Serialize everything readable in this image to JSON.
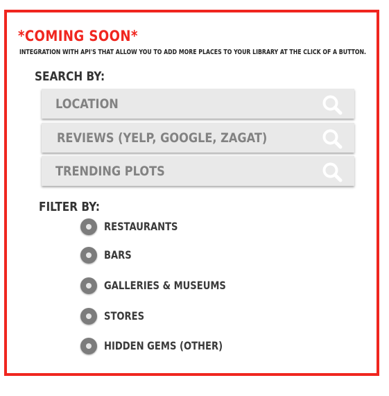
{
  "header": {
    "title": "*COMING SOON*",
    "subtitle": "INTEGRATION WITH API'S THAT ALLOW YOU TO ADD MORE PLACES TO YOUR LIBRARY AT THE CLICK OF A BUTTON."
  },
  "search": {
    "label": "SEARCH BY:",
    "items": [
      {
        "label": "LOCATION",
        "icon": "search-icon"
      },
      {
        "label": "REVIEWS (YELP, GOOGLE, ZAGAT)",
        "icon": "search-icon"
      },
      {
        "label": "TRENDING PLOTS",
        "icon": "search-icon"
      }
    ]
  },
  "filter": {
    "label": "FILTER BY:",
    "options": [
      {
        "label": "RESTAURANTS"
      },
      {
        "label": "BARS"
      },
      {
        "label": "GALLERIES & MUSEUMS"
      },
      {
        "label": "STORES"
      },
      {
        "label": "HIDDEN GEMS (OTHER)"
      }
    ]
  },
  "colors": {
    "accent": "#f0261f",
    "search_bar_bg": "#e9e9e9",
    "search_text": "#828282",
    "radio_fill": "#7c7c7c",
    "label_text": "#333333"
  }
}
